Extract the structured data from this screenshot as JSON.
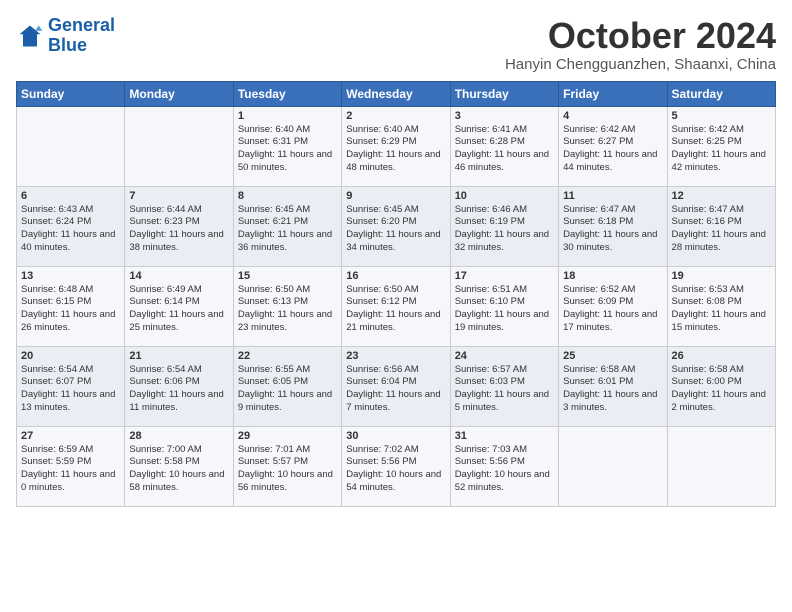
{
  "header": {
    "logo_line1": "General",
    "logo_line2": "Blue",
    "month": "October 2024",
    "location": "Hanyin Chengguanzhen, Shaanxi, China"
  },
  "weekdays": [
    "Sunday",
    "Monday",
    "Tuesday",
    "Wednesday",
    "Thursday",
    "Friday",
    "Saturday"
  ],
  "weeks": [
    [
      {
        "day": "",
        "info": ""
      },
      {
        "day": "",
        "info": ""
      },
      {
        "day": "1",
        "info": "Sunrise: 6:40 AM\nSunset: 6:31 PM\nDaylight: 11 hours and 50 minutes."
      },
      {
        "day": "2",
        "info": "Sunrise: 6:40 AM\nSunset: 6:29 PM\nDaylight: 11 hours and 48 minutes."
      },
      {
        "day": "3",
        "info": "Sunrise: 6:41 AM\nSunset: 6:28 PM\nDaylight: 11 hours and 46 minutes."
      },
      {
        "day": "4",
        "info": "Sunrise: 6:42 AM\nSunset: 6:27 PM\nDaylight: 11 hours and 44 minutes."
      },
      {
        "day": "5",
        "info": "Sunrise: 6:42 AM\nSunset: 6:25 PM\nDaylight: 11 hours and 42 minutes."
      }
    ],
    [
      {
        "day": "6",
        "info": "Sunrise: 6:43 AM\nSunset: 6:24 PM\nDaylight: 11 hours and 40 minutes."
      },
      {
        "day": "7",
        "info": "Sunrise: 6:44 AM\nSunset: 6:23 PM\nDaylight: 11 hours and 38 minutes."
      },
      {
        "day": "8",
        "info": "Sunrise: 6:45 AM\nSunset: 6:21 PM\nDaylight: 11 hours and 36 minutes."
      },
      {
        "day": "9",
        "info": "Sunrise: 6:45 AM\nSunset: 6:20 PM\nDaylight: 11 hours and 34 minutes."
      },
      {
        "day": "10",
        "info": "Sunrise: 6:46 AM\nSunset: 6:19 PM\nDaylight: 11 hours and 32 minutes."
      },
      {
        "day": "11",
        "info": "Sunrise: 6:47 AM\nSunset: 6:18 PM\nDaylight: 11 hours and 30 minutes."
      },
      {
        "day": "12",
        "info": "Sunrise: 6:47 AM\nSunset: 6:16 PM\nDaylight: 11 hours and 28 minutes."
      }
    ],
    [
      {
        "day": "13",
        "info": "Sunrise: 6:48 AM\nSunset: 6:15 PM\nDaylight: 11 hours and 26 minutes."
      },
      {
        "day": "14",
        "info": "Sunrise: 6:49 AM\nSunset: 6:14 PM\nDaylight: 11 hours and 25 minutes."
      },
      {
        "day": "15",
        "info": "Sunrise: 6:50 AM\nSunset: 6:13 PM\nDaylight: 11 hours and 23 minutes."
      },
      {
        "day": "16",
        "info": "Sunrise: 6:50 AM\nSunset: 6:12 PM\nDaylight: 11 hours and 21 minutes."
      },
      {
        "day": "17",
        "info": "Sunrise: 6:51 AM\nSunset: 6:10 PM\nDaylight: 11 hours and 19 minutes."
      },
      {
        "day": "18",
        "info": "Sunrise: 6:52 AM\nSunset: 6:09 PM\nDaylight: 11 hours and 17 minutes."
      },
      {
        "day": "19",
        "info": "Sunrise: 6:53 AM\nSunset: 6:08 PM\nDaylight: 11 hours and 15 minutes."
      }
    ],
    [
      {
        "day": "20",
        "info": "Sunrise: 6:54 AM\nSunset: 6:07 PM\nDaylight: 11 hours and 13 minutes."
      },
      {
        "day": "21",
        "info": "Sunrise: 6:54 AM\nSunset: 6:06 PM\nDaylight: 11 hours and 11 minutes."
      },
      {
        "day": "22",
        "info": "Sunrise: 6:55 AM\nSunset: 6:05 PM\nDaylight: 11 hours and 9 minutes."
      },
      {
        "day": "23",
        "info": "Sunrise: 6:56 AM\nSunset: 6:04 PM\nDaylight: 11 hours and 7 minutes."
      },
      {
        "day": "24",
        "info": "Sunrise: 6:57 AM\nSunset: 6:03 PM\nDaylight: 11 hours and 5 minutes."
      },
      {
        "day": "25",
        "info": "Sunrise: 6:58 AM\nSunset: 6:01 PM\nDaylight: 11 hours and 3 minutes."
      },
      {
        "day": "26",
        "info": "Sunrise: 6:58 AM\nSunset: 6:00 PM\nDaylight: 11 hours and 2 minutes."
      }
    ],
    [
      {
        "day": "27",
        "info": "Sunrise: 6:59 AM\nSunset: 5:59 PM\nDaylight: 11 hours and 0 minutes."
      },
      {
        "day": "28",
        "info": "Sunrise: 7:00 AM\nSunset: 5:58 PM\nDaylight: 10 hours and 58 minutes."
      },
      {
        "day": "29",
        "info": "Sunrise: 7:01 AM\nSunset: 5:57 PM\nDaylight: 10 hours and 56 minutes."
      },
      {
        "day": "30",
        "info": "Sunrise: 7:02 AM\nSunset: 5:56 PM\nDaylight: 10 hours and 54 minutes."
      },
      {
        "day": "31",
        "info": "Sunrise: 7:03 AM\nSunset: 5:56 PM\nDaylight: 10 hours and 52 minutes."
      },
      {
        "day": "",
        "info": ""
      },
      {
        "day": "",
        "info": ""
      }
    ]
  ]
}
